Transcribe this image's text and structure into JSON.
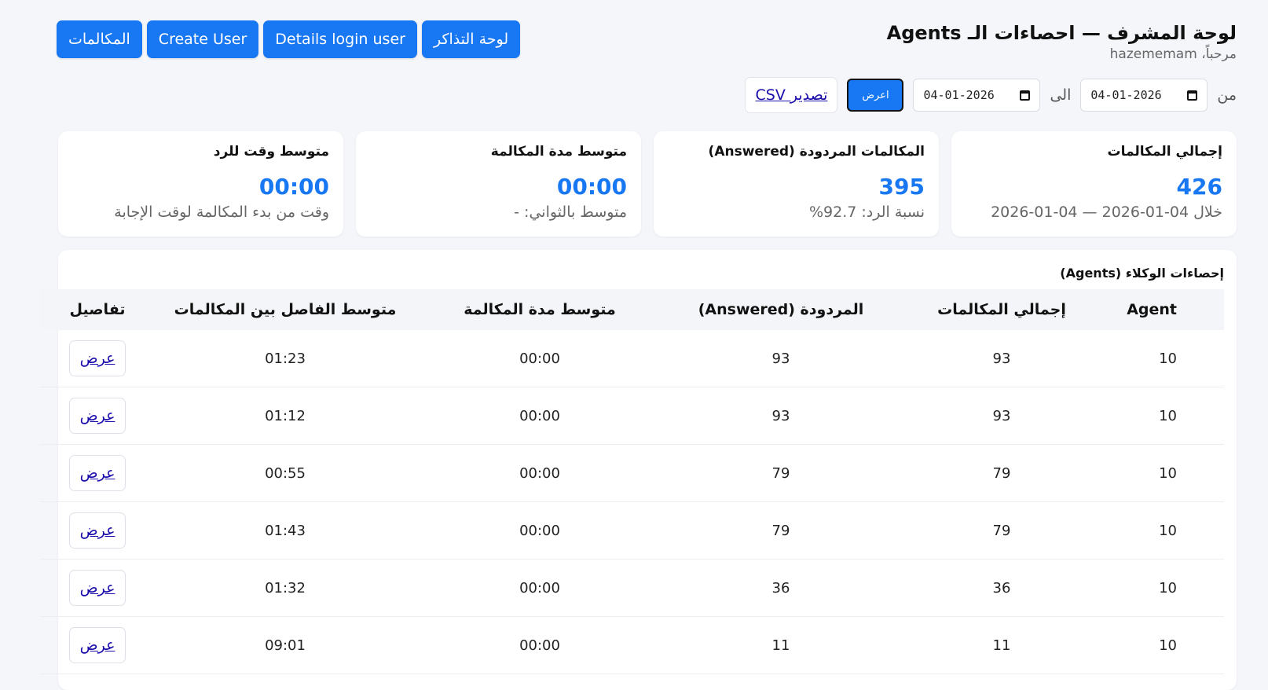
{
  "header": {
    "title": "لوحة المشرف — احصاءات الـ Agents",
    "welcome": "مرحباً، hazememam",
    "nav": [
      {
        "label": "لوحة التذاكر"
      },
      {
        "label": "Details login user"
      },
      {
        "label": "Create User"
      },
      {
        "label": "المكالمات"
      }
    ]
  },
  "filters": {
    "from_label": "من",
    "from_value": "04-01-2026",
    "to_label": "الى",
    "to_value": "04-01-2026",
    "show_label": "اعرض",
    "export_label": "تصدير CSV"
  },
  "cards": [
    {
      "title": "إجمالي المكالمات",
      "value": "426",
      "sub": "خلال 04-01-2026 — 04-01-2026"
    },
    {
      "title": "المكالمات المردودة (Answered)",
      "value": "395",
      "sub": "نسبة الرد: 92.7%"
    },
    {
      "title": "متوسط مدة المكالمة",
      "value": "00:00",
      "sub": "متوسط بالثواني: -"
    },
    {
      "title": "متوسط وقت للرد",
      "value": "00:00",
      "sub": "وقت من بدء المكالمة لوقت الإجابة"
    }
  ],
  "table": {
    "title": "إحصاءات الوكلاء (Agents)",
    "columns": [
      "Agent",
      "إجمالي المكالمات",
      "المردودة (Answered)",
      "متوسط مدة المكالمة",
      "متوسط الفاصل بين المكالمات",
      "تفاصيل"
    ],
    "action_label": "عرض",
    "rows": [
      {
        "agent": "10",
        "total": "93",
        "answered": "93",
        "avg_duration": "00:00",
        "avg_gap": "01:23"
      },
      {
        "agent": "10",
        "total": "93",
        "answered": "93",
        "avg_duration": "00:00",
        "avg_gap": "01:12"
      },
      {
        "agent": "10",
        "total": "79",
        "answered": "79",
        "avg_duration": "00:00",
        "avg_gap": "00:55"
      },
      {
        "agent": "10",
        "total": "79",
        "answered": "79",
        "avg_duration": "00:00",
        "avg_gap": "01:43"
      },
      {
        "agent": "10",
        "total": "36",
        "answered": "36",
        "avg_duration": "00:00",
        "avg_gap": "01:32"
      },
      {
        "agent": "10",
        "total": "11",
        "answered": "11",
        "avg_duration": "00:00",
        "avg_gap": "09:01"
      }
    ]
  }
}
